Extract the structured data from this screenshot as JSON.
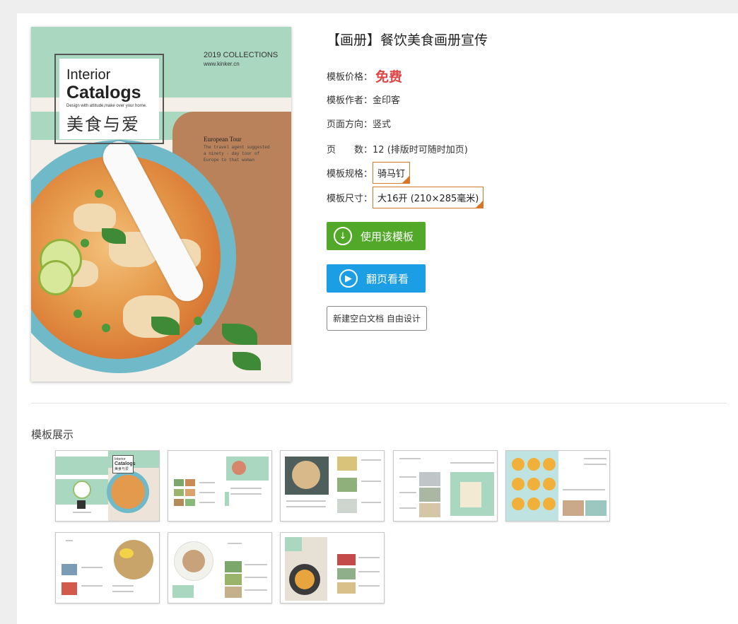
{
  "cover": {
    "title_line1": "Interior",
    "title_line2": "Catalogs",
    "tagline": "Design with attitude,make over your home.",
    "title_cn": "美食与爱",
    "collections": "2019 COLLECTIONS",
    "url": "www.kinker.cn",
    "euro_title": "European Tour",
    "euro_desc": "The travel agent suggested a ninety - day tour of Europe to that woman"
  },
  "info": {
    "title": "【画册】餐饮美食画册宣传",
    "price_label": "模板价格：",
    "price_value": "免费",
    "author_label": "模板作者：",
    "author_value": "金印客",
    "orientation_label": "页面方向：",
    "orientation_value": "竖式",
    "pages_label": "页　　数：",
    "pages_value": "12 (排版时可随时加页)",
    "spec_label": "模板规格：",
    "spec_value": "骑马钉",
    "size_label": "模板尺寸：",
    "size_value": "大16开 (210×285毫米)"
  },
  "actions": {
    "use_label": "使用该模板",
    "flip_label": "翻页看看",
    "blank_label": "新建空白文档 自由设计"
  },
  "showcase": {
    "title": "模板展示",
    "thumb1_l1": "Interior",
    "thumb1_l2": "Catalogs",
    "thumb1_cn": "美食与爱"
  },
  "colors": {
    "accent_green": "#52a829",
    "accent_blue": "#1c9ee4",
    "price_red": "#e04545",
    "mint": "#a9d7c0",
    "spec_border": "#d6772a"
  }
}
